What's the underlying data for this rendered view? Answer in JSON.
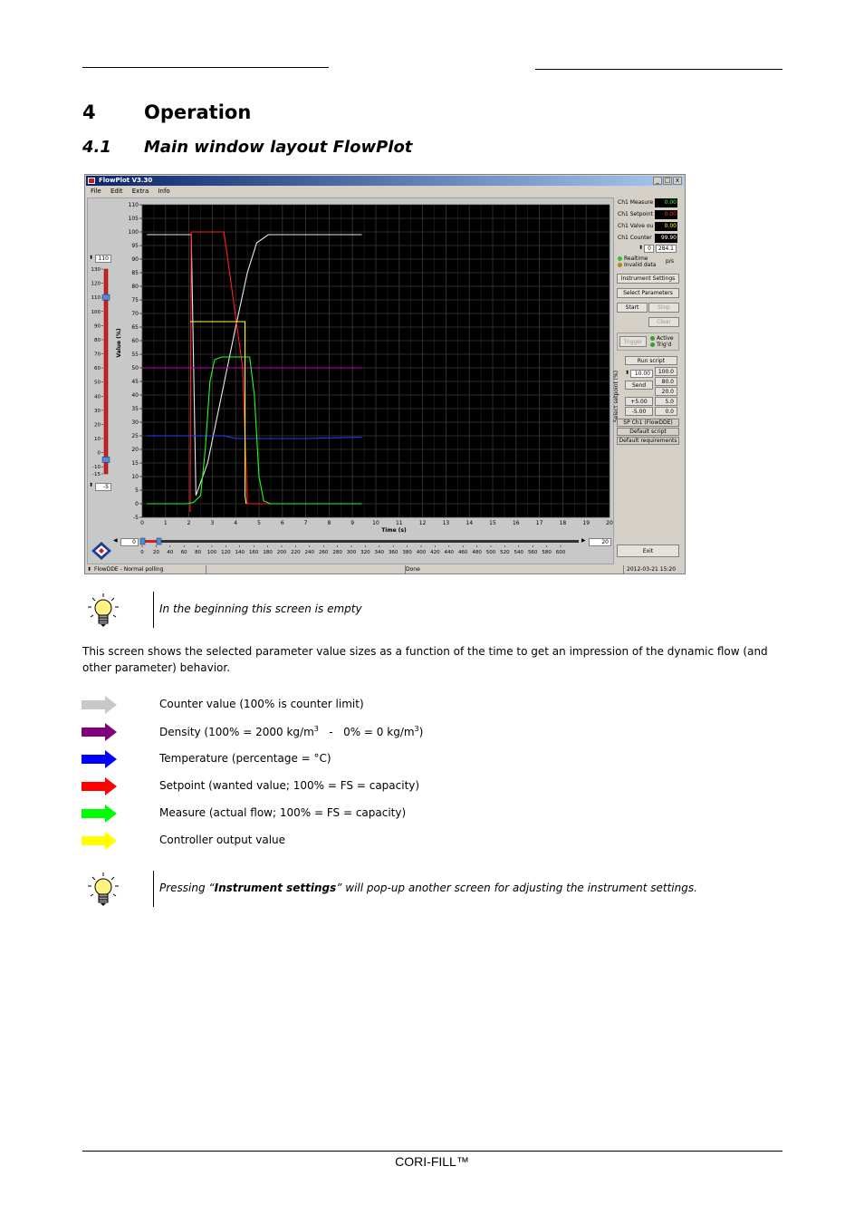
{
  "section": {
    "number": "4",
    "title": "Operation"
  },
  "subsection": {
    "number": "4.1",
    "title": "Main window layout FlowPlot"
  },
  "app": {
    "title": "FlowPlot V3.30",
    "window_buttons": [
      "_",
      "□",
      "x"
    ],
    "menu": [
      "File",
      "Edit",
      "Extra",
      "Info"
    ],
    "chart_data": {
      "type": "line",
      "xlabel": "Time (s)",
      "ylabel": "Value (%)",
      "xlim": [
        0,
        20
      ],
      "ylim": [
        -5,
        110
      ],
      "x_ticks": [
        "0",
        "1",
        "2",
        "3",
        "4",
        "5",
        "6",
        "7",
        "8",
        "9",
        "10",
        "11",
        "12",
        "13",
        "14",
        "15",
        "16",
        "17",
        "18",
        "19",
        "20"
      ],
      "y_ticks": [
        "110",
        "105",
        "100",
        "95",
        "90",
        "85",
        "80",
        "75",
        "70",
        "65",
        "60",
        "55",
        "50",
        "45",
        "40",
        "35",
        "30",
        "25",
        "20",
        "15",
        "10",
        "5",
        "0",
        "-5"
      ],
      "grid": true,
      "series": [
        {
          "color": "#e8e8e8",
          "points": [
            [
              0.2,
              99
            ],
            [
              2.1,
              99
            ],
            [
              2.3,
              3
            ],
            [
              2.8,
              15
            ],
            [
              3.4,
              40
            ],
            [
              4.0,
              65
            ],
            [
              4.5,
              85
            ],
            [
              4.9,
              96
            ],
            [
              5.4,
              99
            ],
            [
              6,
              99
            ],
            [
              9.4,
              99
            ]
          ]
        },
        {
          "color": "#c000c0",
          "points": [
            [
              0,
              50
            ],
            [
              9.4,
              50
            ]
          ]
        },
        {
          "color": "#2040ff",
          "points": [
            [
              0.2,
              25
            ],
            [
              2.8,
              25
            ],
            [
              3.2,
              25
            ],
            [
              3.5,
              25
            ],
            [
              4.0,
              24
            ],
            [
              5,
              24
            ],
            [
              7,
              24
            ],
            [
              9.4,
              24.5
            ]
          ]
        },
        {
          "color": "#ff2020",
          "points": [
            [
              2.05,
              -3
            ],
            [
              2.1,
              100
            ],
            [
              3.5,
              100
            ],
            [
              4.3,
              50
            ],
            [
              4.5,
              0
            ],
            [
              5.3,
              0
            ],
            [
              6,
              0
            ]
          ]
        },
        {
          "color": "#20ff20",
          "points": [
            [
              0.2,
              0
            ],
            [
              1.9,
              0
            ],
            [
              2.2,
              0.5
            ],
            [
              2.5,
              3
            ],
            [
              2.7,
              20
            ],
            [
              2.9,
              45
            ],
            [
              3.1,
              53
            ],
            [
              3.4,
              54
            ],
            [
              4.6,
              54
            ],
            [
              4.8,
              40
            ],
            [
              5.0,
              10
            ],
            [
              5.2,
              1
            ],
            [
              5.5,
              0
            ],
            [
              9.4,
              0
            ]
          ]
        },
        {
          "color": "#ffff40",
          "points": [
            [
              2.05,
              67
            ],
            [
              4.4,
              67
            ],
            [
              4.4,
              3
            ],
            [
              4.45,
              0
            ]
          ]
        }
      ]
    },
    "left_slider": {
      "top_value": "110",
      "bottom_value": "-5",
      "scale": [
        "130",
        "120",
        "110",
        "100",
        "90",
        "80",
        "70",
        "60",
        "50",
        "40",
        "30",
        "20",
        "10",
        "0",
        "-10",
        "-15"
      ]
    },
    "bottom_scroll": {
      "start_value": "0",
      "end_value": "20",
      "scale": [
        "0",
        "20",
        "40",
        "60",
        "80",
        "100",
        "120",
        "140",
        "160",
        "180",
        "200",
        "220",
        "240",
        "260",
        "280",
        "300",
        "320",
        "340",
        "360",
        "380",
        "400",
        "420",
        "440",
        "460",
        "480",
        "500",
        "520",
        "540",
        "560",
        "580",
        "600"
      ]
    },
    "readouts": [
      {
        "label": "Ch1 Measure",
        "value": "0.00",
        "color": "#40ff40"
      },
      {
        "label": "Ch1 Setpoint",
        "value": "0.00",
        "color": "#ff3030"
      },
      {
        "label": "Ch1 Valve ou",
        "value": "0.00",
        "color": "#ffff40"
      },
      {
        "label": "Ch1 Counter",
        "value": "99.90",
        "color": "#ffffff"
      }
    ],
    "sample_index": "0",
    "sample_rate": "284.1",
    "rate_unit": "p/s",
    "status_realtime": "Realtime",
    "status_invalid": "Invalid data",
    "buttons": {
      "instrument_settings": "Instrument Settings",
      "select_parameters": "Select Parameters",
      "start": "Start",
      "stop": "Stop",
      "clear": "Clear",
      "trigger": "Trigger",
      "run_script": "Run script",
      "send": "Send",
      "plus": "+5.00",
      "minus": "-5.00",
      "exit": "Exit"
    },
    "trigger_active": "Active",
    "trigger_trigd": "Trig'd",
    "setpoint_label": "Select setpoint (%)",
    "setpoint_value": "10.00",
    "presets": [
      "100.0",
      "80.0",
      "20.0",
      "5.0",
      "0.0"
    ],
    "script_info": [
      "SP Ch1 (FlowDDE)",
      "Default script",
      "Default requirements"
    ],
    "statusbar": {
      "mode": "FlowDDE - Normal polling",
      "state": "Done",
      "datetime": "2012-03-21  15:20"
    }
  },
  "note1": "In the beginning this screen is empty",
  "paragraph": "This screen shows the selected parameter value sizes as a function of the time to get an impression of the dynamic flow (and other parameter) behavior.",
  "legend": [
    {
      "color": "#c8c8c8",
      "text": "Counter value (100% is counter limit)"
    },
    {
      "color": "#800080",
      "text_prefix": "Density (100% = 2000 kg/m",
      "sup1": "3",
      "text_middle": "   -   0% = 0 kg/m",
      "sup2": "3",
      "text_suffix": ")"
    },
    {
      "color": "#0000ff",
      "text": "Temperature (percentage = °C)"
    },
    {
      "color": "#ff0000",
      "text": "Setpoint (wanted value; 100% = FS = capacity)"
    },
    {
      "color": "#00ff00",
      "text": "Measure (actual flow; 100% = FS = capacity)"
    },
    {
      "color": "#ffff00",
      "text": "Controller output value"
    }
  ],
  "note2": {
    "prefix": "Pressing “",
    "bold": "Instrument settings",
    "suffix": "” will pop-up another screen for adjusting the instrument settings."
  },
  "footer": "CORI-FILL™"
}
